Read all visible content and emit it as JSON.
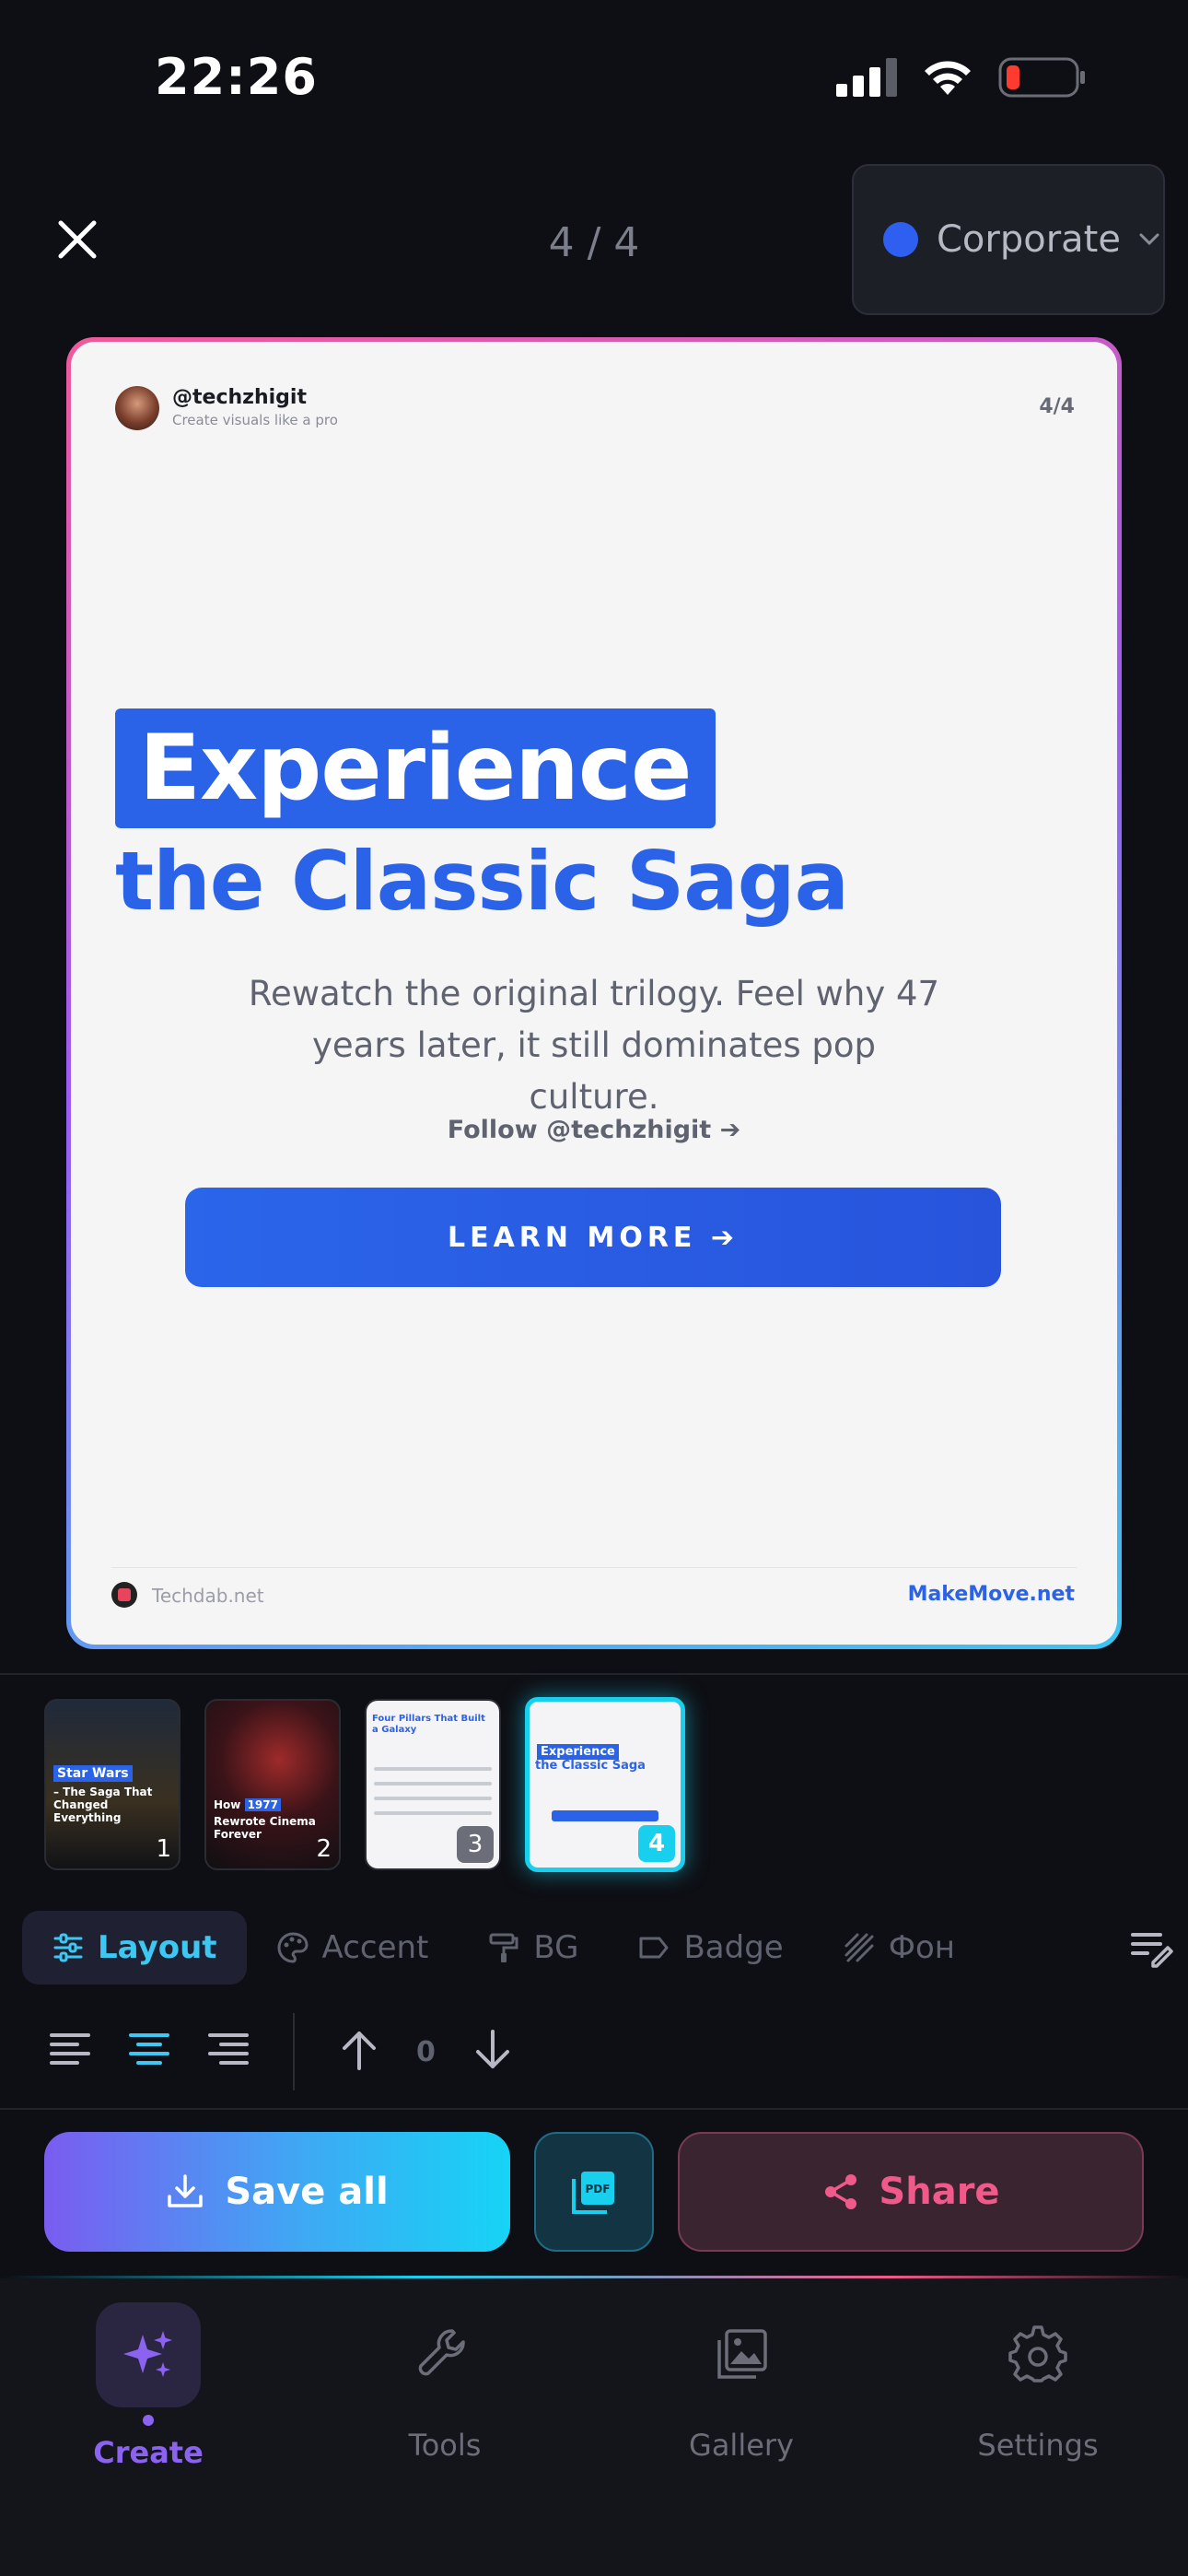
{
  "status_bar": {
    "time": "22:26"
  },
  "top_bar": {
    "page_counter": "4 / 4",
    "theme": "Corporate",
    "theme_color": "#2f5ff0"
  },
  "slide": {
    "handle": "@techzhigit",
    "tagline": "Create visuals like a pro",
    "counter": "4/4",
    "headline_highlight": "Experience",
    "headline_rest": "the Classic Saga",
    "body": "Rewatch the original trilogy. Feel why 47 years later, it still dominates pop culture.",
    "follow": "Follow @techzhigit ➔",
    "cta": "LEARN MORE ➔",
    "footer_left": "Techdab.net",
    "footer_right": "MakeMove.net",
    "accent": "#2b63e8"
  },
  "thumbnails": [
    {
      "number": "1",
      "label": "Star Wars",
      "text": "– The Saga That Changed Everything"
    },
    {
      "number": "2",
      "label": "1977",
      "text_before": "How",
      "text": "Rewrote Cinema Forever"
    },
    {
      "number": "3",
      "title": "Four Pillars That Built a Galaxy"
    },
    {
      "number": "4",
      "label": "Experience",
      "text": "the Classic Saga",
      "active": true
    }
  ],
  "tabs": [
    {
      "label": "Layout",
      "icon": "sliders-icon",
      "active": true
    },
    {
      "label": "Accent",
      "icon": "palette-icon"
    },
    {
      "label": "BG",
      "icon": "paint-roller-icon"
    },
    {
      "label": "Badge",
      "icon": "tag-icon"
    },
    {
      "label": "Фон",
      "icon": "pattern-icon"
    }
  ],
  "alignment": {
    "selected": "center",
    "offset": "0"
  },
  "actions": {
    "save": "Save all",
    "pdf": "PDF",
    "share": "Share"
  },
  "nav": [
    {
      "label": "Create",
      "icon": "sparkles-icon",
      "active": true
    },
    {
      "label": "Tools",
      "icon": "wrench-icon"
    },
    {
      "label": "Gallery",
      "icon": "gallery-icon"
    },
    {
      "label": "Settings",
      "icon": "gear-icon"
    }
  ]
}
